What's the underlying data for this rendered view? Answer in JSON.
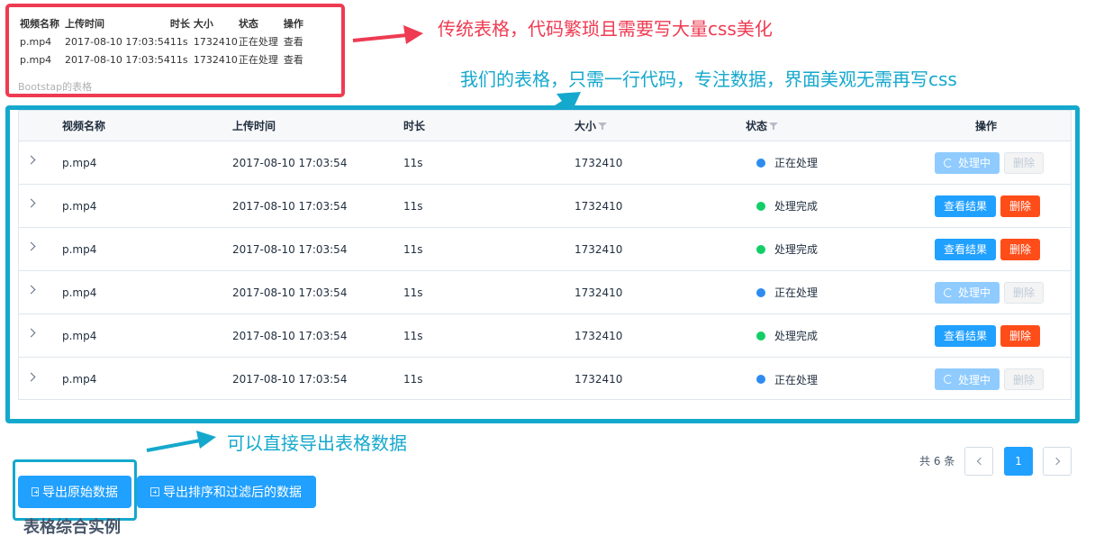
{
  "traditional_table": {
    "headers": [
      "视频名称",
      "上传时间",
      "时长",
      "大小",
      "状态",
      "操作"
    ],
    "rows": [
      [
        "p.mp4",
        "2017-08-10 17:03:54",
        "11s",
        "1732410",
        "正在处理",
        "查看"
      ],
      [
        "p.mp4",
        "2017-08-10 17:03:54",
        "11s",
        "1732410",
        "正在处理",
        "查看"
      ]
    ],
    "caption": "Bootstap的表格"
  },
  "annotations": {
    "traditional_note": "传统表格，代码繁琐且需要写大量css美化",
    "our_table_note": "我们的表格，只需一行代码，专注数据，界面美观无需再写css",
    "export_note": "可以直接导出表格数据"
  },
  "colors": {
    "red_annotation": "#ee3b52",
    "teal_annotation": "#15a8cd",
    "primary": "#20a0ff",
    "danger": "#ff4d1a",
    "status_processing": "#2d8cf0",
    "status_done": "#13ce66"
  },
  "table": {
    "headers": {
      "name": "视频名称",
      "time": "上传时间",
      "duration": "时长",
      "size": "大小",
      "status": "状态",
      "ops": "操作"
    },
    "rows": [
      {
        "name": "p.mp4",
        "time": "2017-08-10 17:03:54",
        "duration": "11s",
        "size": "1732410",
        "status": "正在处理",
        "state": "processing"
      },
      {
        "name": "p.mp4",
        "time": "2017-08-10 17:03:54",
        "duration": "11s",
        "size": "1732410",
        "status": "处理完成",
        "state": "done"
      },
      {
        "name": "p.mp4",
        "time": "2017-08-10 17:03:54",
        "duration": "11s",
        "size": "1732410",
        "status": "处理完成",
        "state": "done"
      },
      {
        "name": "p.mp4",
        "time": "2017-08-10 17:03:54",
        "duration": "11s",
        "size": "1732410",
        "status": "正在处理",
        "state": "processing"
      },
      {
        "name": "p.mp4",
        "time": "2017-08-10 17:03:54",
        "duration": "11s",
        "size": "1732410",
        "status": "处理完成",
        "state": "done"
      },
      {
        "name": "p.mp4",
        "time": "2017-08-10 17:03:54",
        "duration": "11s",
        "size": "1732410",
        "status": "正在处理",
        "state": "processing"
      }
    ],
    "actions": {
      "processing_label": "处理中",
      "view_label": "查看结果",
      "delete_label": "删除"
    }
  },
  "pagination": {
    "total": "共 6 条",
    "current_page": "1"
  },
  "export": {
    "raw_label": "导出原始数据",
    "filtered_label": "导出排序和过滤后的数据"
  },
  "section_title": "表格综合实例"
}
